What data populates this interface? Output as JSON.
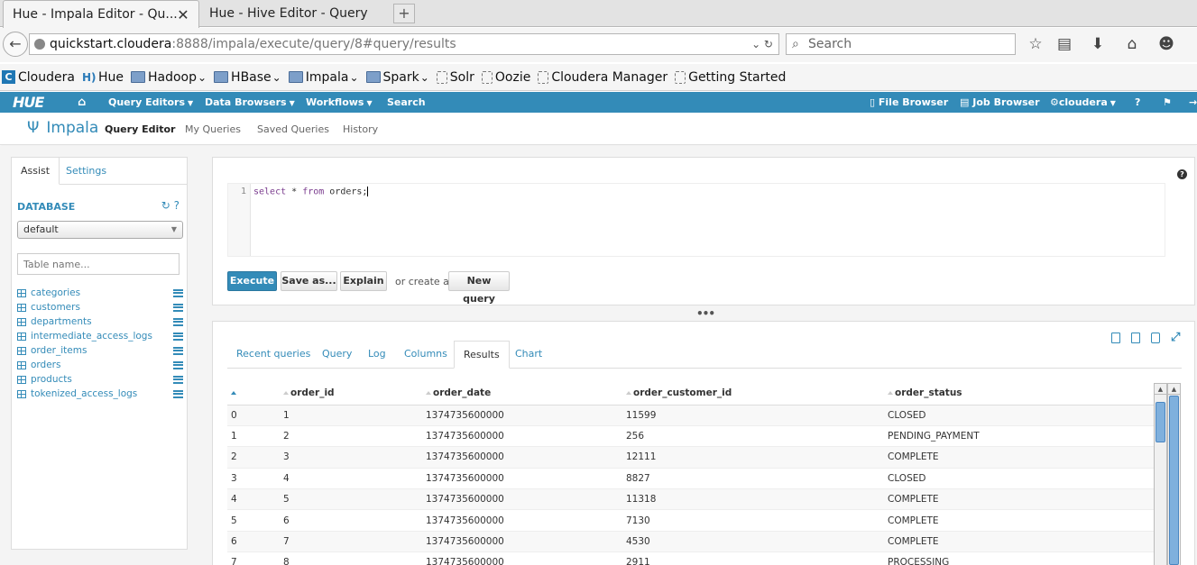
{
  "browser": {
    "tabs": [
      {
        "title": "Hue - Impala Editor - Qu..."
      },
      {
        "title": "Hue - Hive Editor - Query"
      }
    ],
    "url_host": "quickstart.cloudera",
    "url_path": ":8888/impala/execute/query/8#query/results",
    "search_placeholder": "Search",
    "bookmarks": [
      "Cloudera",
      "Hue",
      "Hadoop",
      "HBase",
      "Impala",
      "Spark",
      "Solr",
      "Oozie",
      "Cloudera Manager",
      "Getting Started"
    ]
  },
  "hue": {
    "logo": "HUE",
    "top_nav": {
      "query_editors": "Query Editors",
      "data_browsers": "Data Browsers",
      "workflows": "Workflows",
      "search": "Search",
      "file_browser": "File Browser",
      "job_browser": "Job Browser",
      "user": "cloudera"
    },
    "sub_nav": {
      "brand": "Impala",
      "query_editor": "Query Editor",
      "my_queries": "My Queries",
      "saved_queries": "Saved Queries",
      "history": "History"
    }
  },
  "assist": {
    "tab_assist": "Assist",
    "tab_settings": "Settings",
    "database_label": "DATABASE",
    "database_selected": "default",
    "filter_placeholder": "Table name...",
    "tables": [
      "categories",
      "customers",
      "departments",
      "intermediate_access_logs",
      "order_items",
      "orders",
      "products",
      "tokenized_access_logs"
    ]
  },
  "editor": {
    "line_number": "1",
    "query_kw1": "select",
    "query_mid": " * ",
    "query_kw2": "from",
    "query_end": " orders;",
    "execute": "Execute",
    "save_as": "Save as...",
    "explain": "Explain",
    "or_create": "or create a",
    "new_query": "New query"
  },
  "results": {
    "tabs": [
      "Recent queries",
      "Query",
      "Log",
      "Columns",
      "Results",
      "Chart"
    ],
    "active_tab": "Results",
    "columns": [
      "order_id",
      "order_date",
      "order_customer_id",
      "order_status"
    ],
    "rows": [
      [
        "0",
        "1",
        "1374735600000",
        "11599",
        "CLOSED"
      ],
      [
        "1",
        "2",
        "1374735600000",
        "256",
        "PENDING_PAYMENT"
      ],
      [
        "2",
        "3",
        "1374735600000",
        "12111",
        "COMPLETE"
      ],
      [
        "3",
        "4",
        "1374735600000",
        "8827",
        "CLOSED"
      ],
      [
        "4",
        "5",
        "1374735600000",
        "11318",
        "COMPLETE"
      ],
      [
        "5",
        "6",
        "1374735600000",
        "7130",
        "COMPLETE"
      ],
      [
        "6",
        "7",
        "1374735600000",
        "4530",
        "COMPLETE"
      ],
      [
        "7",
        "8",
        "1374735600000",
        "2911",
        "PROCESSING"
      ]
    ]
  },
  "colors": {
    "hue_blue": "#338bb8"
  }
}
